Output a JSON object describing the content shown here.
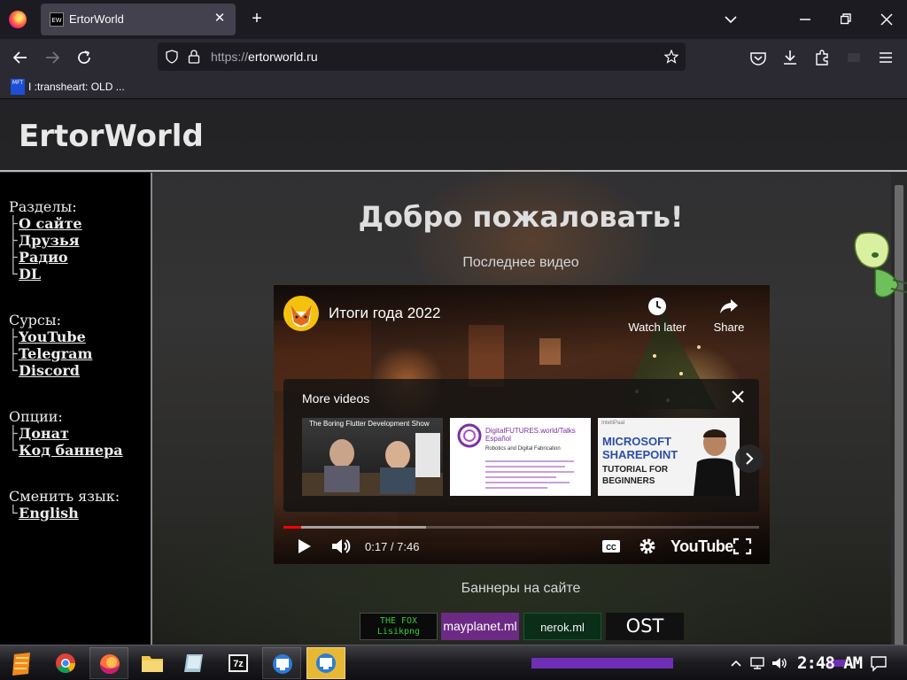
{
  "browser": {
    "tab": {
      "title": "ErtorWorld",
      "favicon_text": "EW"
    },
    "url": {
      "protocol": "https://",
      "host": "ertorworld.ru"
    },
    "bookmark": {
      "icon_text": "MFT",
      "label": "I :transheart: OLD ..."
    }
  },
  "site": {
    "title": "ErtorWorld",
    "sidebar": {
      "sections": [
        {
          "heading": "Разделы:",
          "links": [
            {
              "tree": "├",
              "label": "О сайте"
            },
            {
              "tree": "├",
              "label": "Друзья"
            },
            {
              "tree": "├",
              "label": "Радио"
            },
            {
              "tree": "└",
              "label": "DL"
            }
          ]
        },
        {
          "heading": "Сурсы:",
          "links": [
            {
              "tree": "├",
              "label": "YouTube"
            },
            {
              "tree": "├",
              "label": "Telegram"
            },
            {
              "tree": "└",
              "label": "Discord"
            }
          ]
        },
        {
          "heading": "Опции:",
          "links": [
            {
              "tree": "├",
              "label": "Донат"
            },
            {
              "tree": "└",
              "label": "Код баннера"
            }
          ]
        },
        {
          "heading": "Сменить язык:",
          "links": [
            {
              "tree": "└",
              "label": "English"
            }
          ]
        }
      ]
    },
    "welcome": "Добро пожаловать!",
    "latest_video_label": "Последнее видео",
    "banners_label": "Баннеры на сайте",
    "banners": [
      {
        "line1": "THE FOX",
        "line2": "Lisikpng"
      },
      {
        "text": "mayplanet.ml"
      },
      {
        "text": "nerok.ml"
      },
      {
        "text": "OST"
      }
    ]
  },
  "video": {
    "title": "Итоги года 2022",
    "watch_later": "Watch later",
    "share": "Share",
    "more_videos": "More videos",
    "thumbnails": [
      {
        "title": "The Boring Flutter Development Show"
      },
      {
        "brand": "DigitalFUTURES.world/Talks Español",
        "subtitle": "Robotics and Digital Fabrication"
      },
      {
        "brand": "IntelliPaat",
        "line1": "MICROSOFT",
        "line2": "SHAREPOINT",
        "line3": "TUTORIAL FOR",
        "line4": "BEGINNERS"
      }
    ],
    "time": "0:17 / 7:46",
    "played_fraction": 0.037,
    "buffered_fraction": 0.3,
    "logo": "YouTube"
  },
  "taskbar": {
    "clock": "2:48 AM"
  },
  "colors": {
    "accent_purple": "#6e2fb5",
    "yt_red": "#ff0000",
    "taskbar_active": "#e6b836"
  }
}
